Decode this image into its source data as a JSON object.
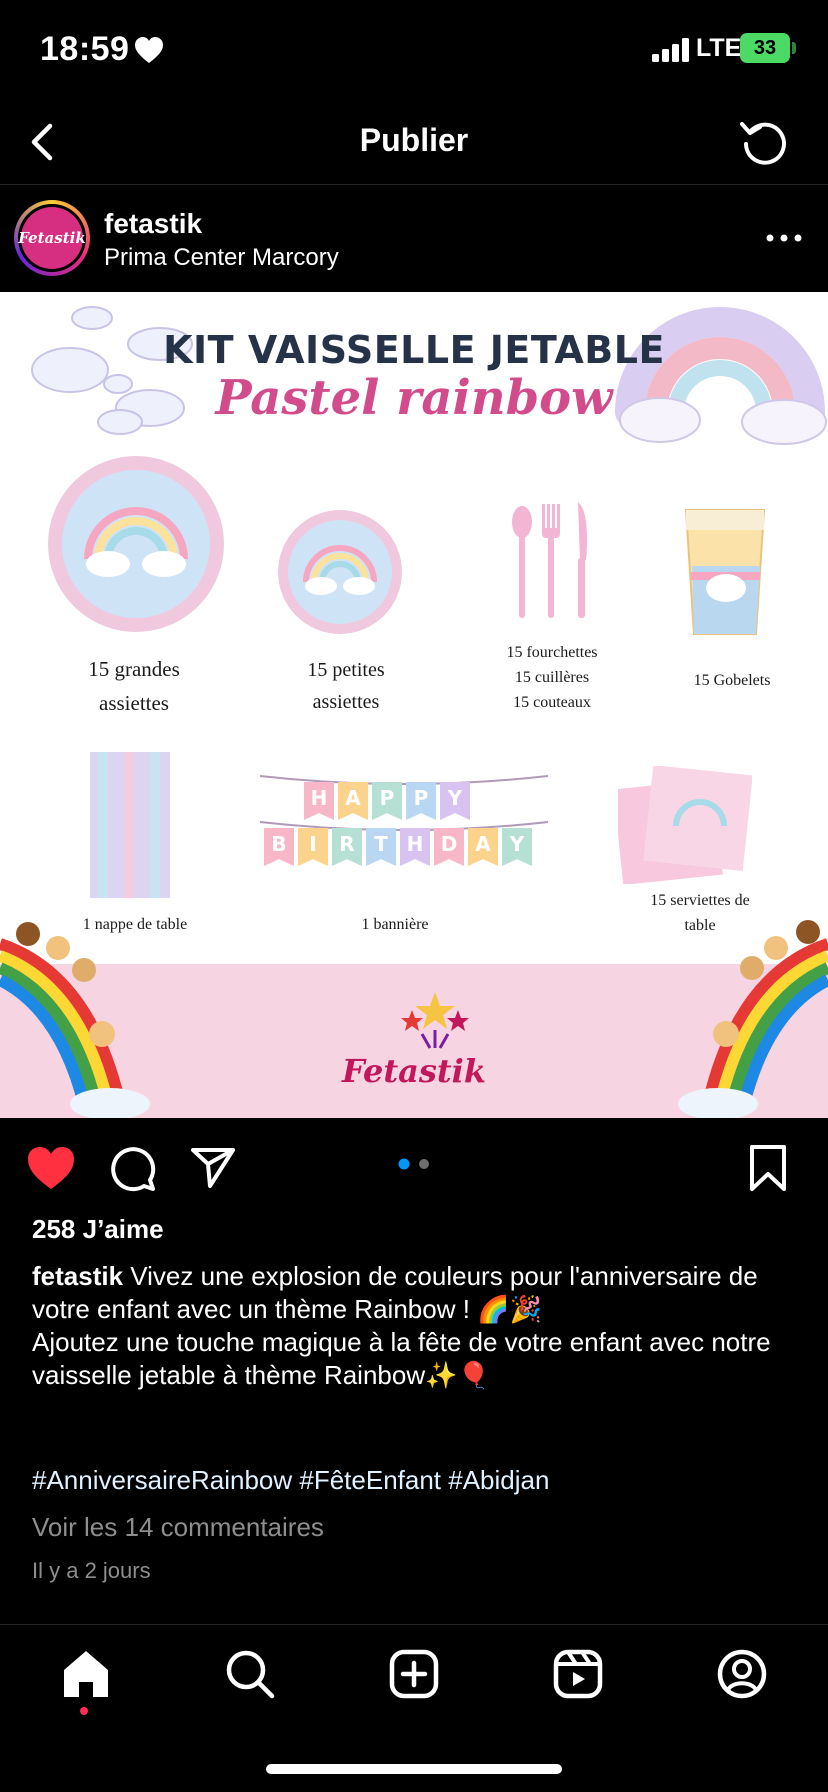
{
  "status_bar": {
    "time": "18:59",
    "network": "LTE",
    "battery": "33"
  },
  "header": {
    "title": "Publier"
  },
  "post_header": {
    "username": "fetastik",
    "location": "Prima Center Marcory",
    "avatar_text": "Fetastik"
  },
  "post_image": {
    "title": "KIT VAISSELLE JETABLE",
    "subtitle": "Pastel rainbow",
    "items": {
      "big_plates_1": "15 grandes",
      "big_plates_2": "assiettes",
      "small_plates_1": "15 petites",
      "small_plates_2": "assiettes",
      "cutlery_1": "15 fourchettes",
      "cutlery_2": "15 cuillères",
      "cutlery_3": "15 couteaux",
      "cups": "15 Gobelets",
      "tablecloth": "1 nappe de table",
      "banner": "1 bannière",
      "napkins_1": "15 serviettes de",
      "napkins_2": "table"
    },
    "banner_letters_1": [
      "H",
      "A",
      "P",
      "P",
      "Y"
    ],
    "banner_letters_2": [
      "B",
      "I",
      "R",
      "T",
      "H",
      "D",
      "A",
      "Y"
    ],
    "brand": "Fetastik"
  },
  "actions": {
    "like_color": "#ff3040",
    "carousel_pages": 2,
    "carousel_active": 1
  },
  "likes": "258 J’aime",
  "caption": {
    "username": "fetastik",
    "line1": "Vivez une explosion de couleurs pour l'anniversaire de votre enfant avec un thème Rainbow ! 🌈🎉",
    "line2": "Ajoutez une touche magique à la fête de votre enfant avec notre vaisselle jetable à thème Rainbow✨🎈"
  },
  "hashtags": "#AnniversaireRainbow #FêteEnfant #Abidjan",
  "comments_link": "Voir les 14 commentaires",
  "time_ago": "Il y a 2 jours",
  "bottom_nav": [
    "home-icon",
    "search-icon",
    "create-icon",
    "reels-icon",
    "profile-icon"
  ]
}
